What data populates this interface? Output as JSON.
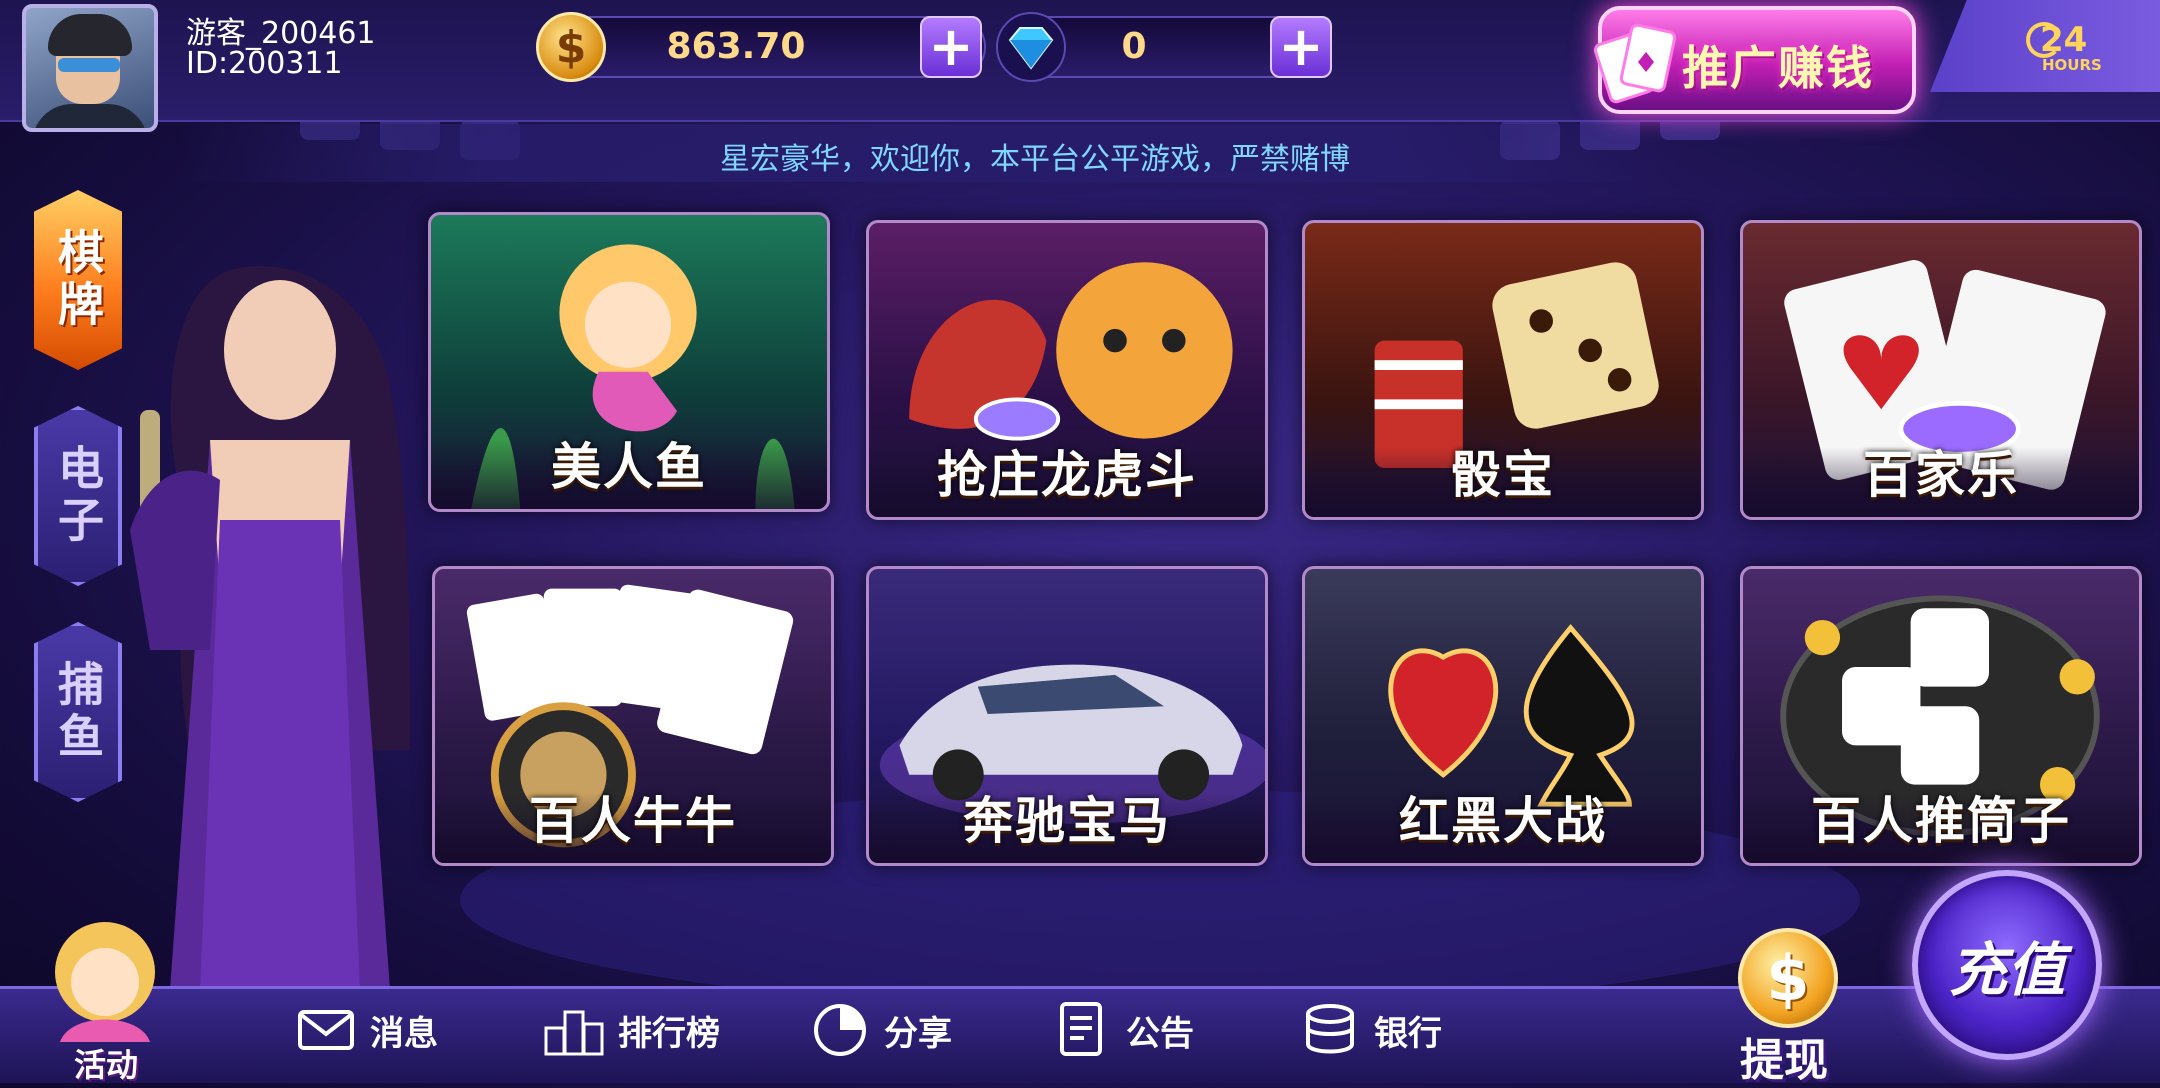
{
  "header": {
    "username": "游客_200461",
    "user_id": "ID:200311",
    "gold_balance": "863.70",
    "diamond_balance": "0",
    "coin_symbol": "$",
    "plus_symbol": "+",
    "promo_label": "推广赚钱",
    "support_number": "24",
    "support_hours": "HOURS"
  },
  "ticker": {
    "message": "星宏豪华，欢迎你，本平台公平游戏，严禁赌博"
  },
  "sidenav": {
    "items": [
      {
        "label": "棋牌",
        "active": true
      },
      {
        "label": "电子",
        "active": false
      },
      {
        "label": "捕鱼",
        "active": false
      }
    ]
  },
  "games": [
    {
      "title": "美人鱼"
    },
    {
      "title": "抢庄龙虎斗"
    },
    {
      "title": "骰宝"
    },
    {
      "title": "百家乐"
    },
    {
      "title": "百人牛牛"
    },
    {
      "title": "奔驰宝马"
    },
    {
      "title": "红黑大战"
    },
    {
      "title": "百人推筒子"
    }
  ],
  "bottombar": {
    "activity": "活动",
    "messages": "消息",
    "leaderboard": "排行榜",
    "share": "分享",
    "notice": "公告",
    "bank": "银行",
    "withdraw": "提现",
    "withdraw_symbol": "$",
    "recharge": "充值"
  },
  "colors": {
    "accent_gold": "#ffd98a",
    "ticker_text": "#7fd7ff",
    "active_tab": "#ff7e1e",
    "promo_pink": "#c21fb3"
  }
}
